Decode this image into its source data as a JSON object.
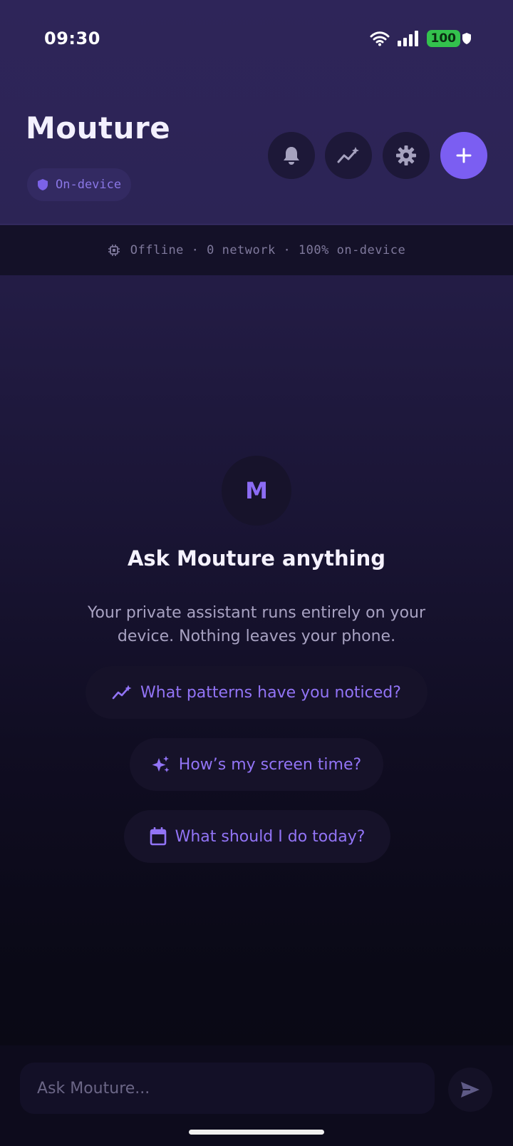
{
  "status_bar": {
    "time": "09:30",
    "battery": "100"
  },
  "header": {
    "title": "Mouture",
    "badge_label": "On-device",
    "icons": [
      "bell-icon",
      "insights-icon",
      "gear-icon",
      "plus-icon"
    ]
  },
  "offline_strip": {
    "text": "Offline · 0 network · 100% on-device",
    "icon": "chip-icon"
  },
  "empty_state": {
    "avatar_letter": "M",
    "headline": "Ask Mouture anything",
    "subtitle": "Your private assistant runs entirely on your device. Nothing leaves your phone.",
    "suggestions": [
      {
        "label": "What patterns have you noticed?",
        "icon": "trend-icon"
      },
      {
        "label": "How’s my screen time?",
        "icon": "sparkle-icon"
      },
      {
        "label": "What should I do today?",
        "icon": "calendar-icon"
      }
    ]
  },
  "composer": {
    "placeholder": "Ask Mouture..."
  },
  "colors": {
    "accent": "#7b5ef2",
    "battery": "#33c24d",
    "background": "#0a0914"
  }
}
